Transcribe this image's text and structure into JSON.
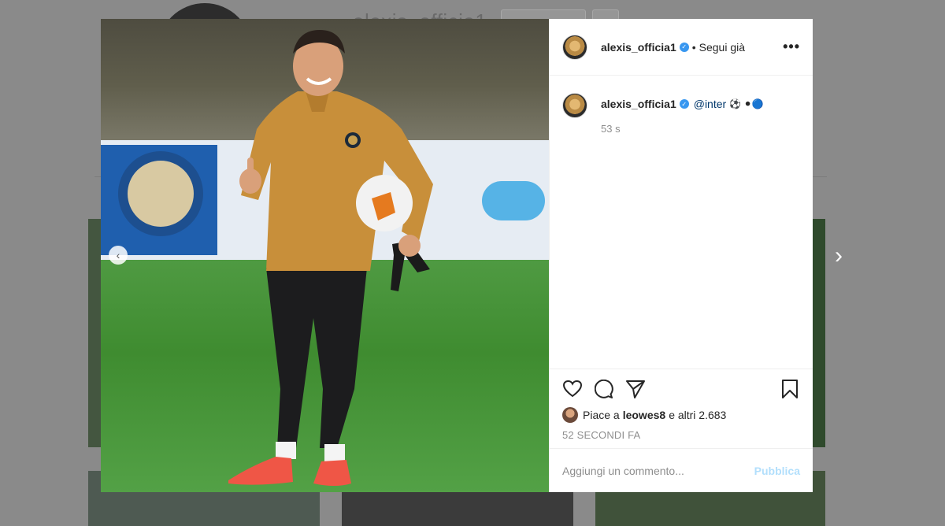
{
  "background": {
    "profile_name": "alexis_officia1"
  },
  "post": {
    "username": "alexis_officia1",
    "follow_status": "Segui già",
    "more_label": "•••",
    "caption": {
      "username": "alexis_officia1",
      "mention": "@inter",
      "emojis": "⚽ ⚫🔵",
      "time": "53 s"
    },
    "likes": {
      "prefix": "Piace a",
      "user": "leowes8",
      "suffix": "e altri 2.683"
    },
    "posted_ago": "52 SECONDI FA",
    "comment_placeholder": "Aggiungi un commento...",
    "publish_label": "Pubblica"
  },
  "icons": {
    "like": "heart-icon",
    "comment": "comment-icon",
    "share": "share-icon",
    "save": "bookmark-icon",
    "prev": "chevron-left-icon",
    "next": "chevron-right-icon"
  },
  "colors": {
    "verified": "#3897f0",
    "publish_disabled": "#b2dffc",
    "mention": "#00376b"
  }
}
